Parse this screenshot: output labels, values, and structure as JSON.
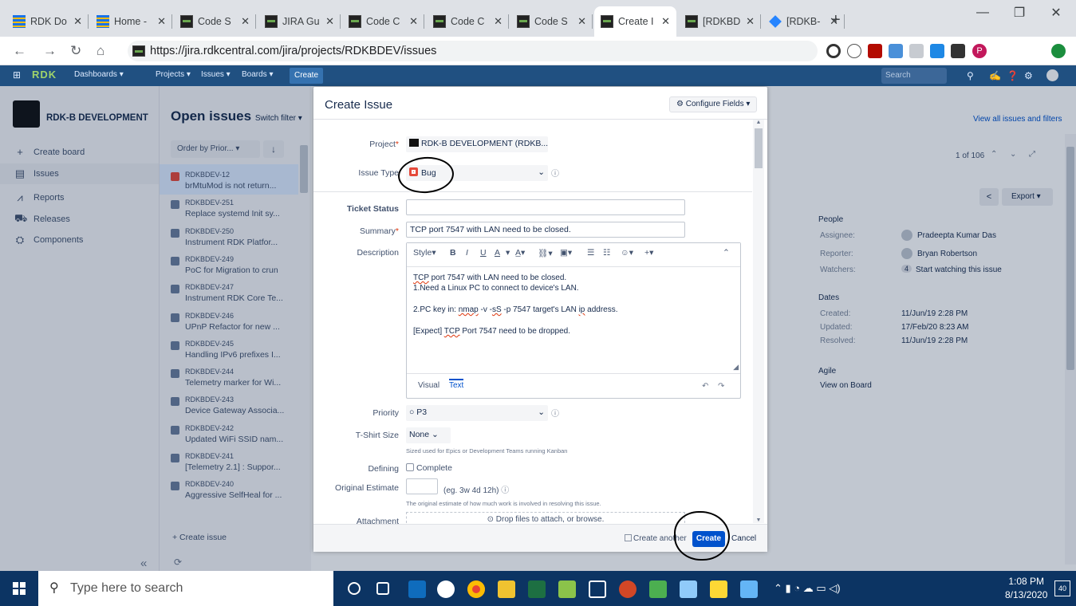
{
  "browser": {
    "tabs": [
      {
        "title": "RDK Do",
        "icon": "lines"
      },
      {
        "title": "Home -",
        "icon": "lines"
      },
      {
        "title": "Code S",
        "icon": "rdk"
      },
      {
        "title": "JIRA Gu",
        "icon": "rdk"
      },
      {
        "title": "Code C",
        "icon": "rdk"
      },
      {
        "title": "Code C",
        "icon": "rdk"
      },
      {
        "title": "Code S",
        "icon": "rdk"
      },
      {
        "title": "Create I",
        "icon": "rdk",
        "active": true
      },
      {
        "title": "[RDKBD",
        "icon": "rdk"
      },
      {
        "title": "[RDKB-",
        "icon": "diamond"
      }
    ],
    "url": "https://jira.rdkcentral.com/jira/projects/RDKBDEV/issues",
    "profile_initial": "P",
    "close_glyph": "✕",
    "newtab_glyph": "+"
  },
  "jira_header": {
    "logo": "RDK",
    "nav": [
      "Dashboards ▾",
      "Projects ▾",
      "Issues ▾",
      "Boards ▾"
    ],
    "create": "Create",
    "search_placeholder": "Search"
  },
  "sidebar": {
    "project_name": "RDK-B DEVELOPMENT",
    "items": [
      {
        "label": "Create board",
        "icon": "plus-icon",
        "glyph": "+"
      },
      {
        "label": "Issues",
        "icon": "issues-icon",
        "glyph": "▤"
      },
      {
        "label": "Reports",
        "icon": "reports-icon",
        "glyph": "⩘"
      },
      {
        "label": "Releases",
        "icon": "releases-icon",
        "glyph": "⛟"
      },
      {
        "label": "Components",
        "icon": "components-icon",
        "glyph": "⛭"
      }
    ],
    "collapse_glyph": "«"
  },
  "issue_list": {
    "title": "Open issues",
    "switch_filter": "Switch filter ▾",
    "order_by": "Order by Prior... ▾",
    "create_issue": "+ Create issue",
    "issues": [
      {
        "key": "RDKBDEV-12",
        "summary": "brMtuMod is not return...",
        "type": "bug"
      },
      {
        "key": "RDKBDEV-251",
        "summary": "Replace systemd Init sy...",
        "type": "task"
      },
      {
        "key": "RDKBDEV-250",
        "summary": "Instrument RDK Platfor...",
        "type": "task"
      },
      {
        "key": "RDKBDEV-249",
        "summary": "PoC for Migration to crun",
        "type": "task"
      },
      {
        "key": "RDKBDEV-247",
        "summary": "Instrument RDK Core Te...",
        "type": "task"
      },
      {
        "key": "RDKBDEV-246",
        "summary": "UPnP Refactor for new ...",
        "type": "task"
      },
      {
        "key": "RDKBDEV-245",
        "summary": "Handling IPv6 prefixes I...",
        "type": "task"
      },
      {
        "key": "RDKBDEV-244",
        "summary": "Telemetry marker for Wi...",
        "type": "task"
      },
      {
        "key": "RDKBDEV-243",
        "summary": "Device Gateway Associa...",
        "type": "task"
      },
      {
        "key": "RDKBDEV-242",
        "summary": "Updated WiFi SSID nam...",
        "type": "task"
      },
      {
        "key": "RDKBDEV-241",
        "summary": "[Telemetry 2.1] : Suppor...",
        "type": "task"
      },
      {
        "key": "RDKBDEV-240",
        "summary": "Aggressive SelfHeal for ...",
        "type": "task"
      }
    ]
  },
  "right_panel": {
    "view_all": "View all issues and filters",
    "pager": "1 of 106",
    "export": "Export ▾",
    "people_title": "People",
    "assignee_label": "Assignee:",
    "assignee": "Pradeepta Kumar Das",
    "reporter_label": "Reporter:",
    "reporter": "Bryan Robertson",
    "watchers_label": "Watchers:",
    "watchers_count": "4",
    "watchers_action": "Start watching this issue",
    "dates_title": "Dates",
    "created_label": "Created:",
    "created": "11/Jun/19 2:28 PM",
    "updated_label": "Updated:",
    "updated": "17/Feb/20 8:23 AM",
    "resolved_label": "Resolved:",
    "resolved": "11/Jun/19 2:28 PM",
    "agile_title": "Agile",
    "view_on_board": "View on Board"
  },
  "dialog": {
    "title": "Create Issue",
    "configure_fields": "Configure Fields ▾",
    "project_label": "Project",
    "project_value": "RDK-B DEVELOPMENT (RDKB...",
    "issue_type_label": "Issue Type",
    "issue_type_value": "Bug",
    "ticket_status_label": "Ticket Status",
    "ticket_status_value": "",
    "summary_label": "Summary",
    "summary_value": "TCP port 7547 with LAN need to be closed.",
    "description_label": "Description",
    "toolbar": [
      "Style▾",
      "B",
      "I",
      "U",
      "A",
      "▾",
      "A̲▾",
      "⛓▾",
      "▣▾",
      "☰",
      "☷",
      "☺▾",
      "+▾"
    ],
    "description_lines": [
      "TCP port 7547 with LAN need to be closed.",
      "1.Need a Linux PC to connect to device's LAN.",
      "",
      "2.PC key in: nmap -v -sS -p 7547 target's LAN ip address.",
      "",
      "[Expect] TCP Port 7547 need to be dropped."
    ],
    "editor_tab_visual": "Visual",
    "editor_tab_text": "Text",
    "priority_label": "Priority",
    "priority_value": "P3",
    "tshirt_label": "T-Shirt Size",
    "tshirt_value": "None",
    "tshirt_hint": "Sized used for Epics or Development Teams running Kanban",
    "defining_label": "Defining",
    "defining_option": "Complete",
    "estimate_label": "Original Estimate",
    "estimate_value": "",
    "estimate_example": "(eg. 3w 4d 12h)",
    "estimate_hint": "The original estimate of how much work is involved in resolving this issue.",
    "attachment_label": "Attachment",
    "attachment_text": "Drop files to attach, or browse.",
    "create_another": "Create another",
    "create_button": "Create",
    "cancel": "Cancel"
  },
  "taskbar": {
    "search_placeholder": "Type here to search",
    "time": "1:08 PM",
    "date": "8/13/2020",
    "notifications": "40"
  },
  "colors": {
    "jira_blue": "#205081",
    "create_blue": "#0052cc",
    "bug_red": "#e5493a",
    "taskbar": "#0c3463"
  }
}
